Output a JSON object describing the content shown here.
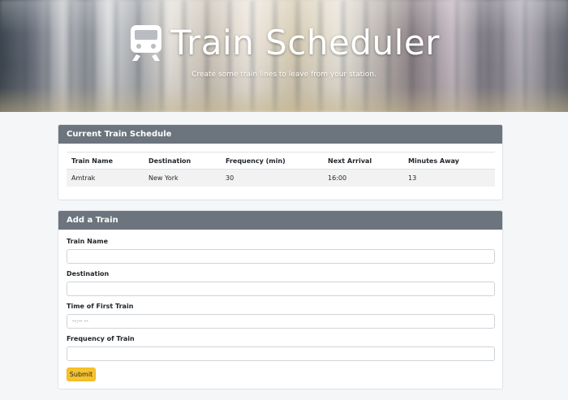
{
  "hero": {
    "title": "Train Scheduler",
    "subtitle": "Create some train lines to leave from your station.",
    "icon": "train-icon"
  },
  "schedule": {
    "header": "Current Train Schedule",
    "columns": [
      "Train Name",
      "Destination",
      "Frequency (min)",
      "Next Arrival",
      "Minutes Away"
    ],
    "rows": [
      [
        "Amtrak",
        "New York",
        "30",
        "16:00",
        "13"
      ]
    ]
  },
  "add_train": {
    "header": "Add a Train",
    "fields": [
      {
        "label": "Train Name",
        "value": "",
        "placeholder": ""
      },
      {
        "label": "Destination",
        "value": "",
        "placeholder": ""
      },
      {
        "label": "Time of First Train",
        "value": "",
        "placeholder": "--:-- --"
      },
      {
        "label": "Frequency of Train",
        "value": "",
        "placeholder": ""
      }
    ],
    "submit_label": "Submit"
  },
  "colors": {
    "card_header": "#6c757d",
    "submit": "#f6c22d",
    "page_bg": "#f5f6f8"
  }
}
